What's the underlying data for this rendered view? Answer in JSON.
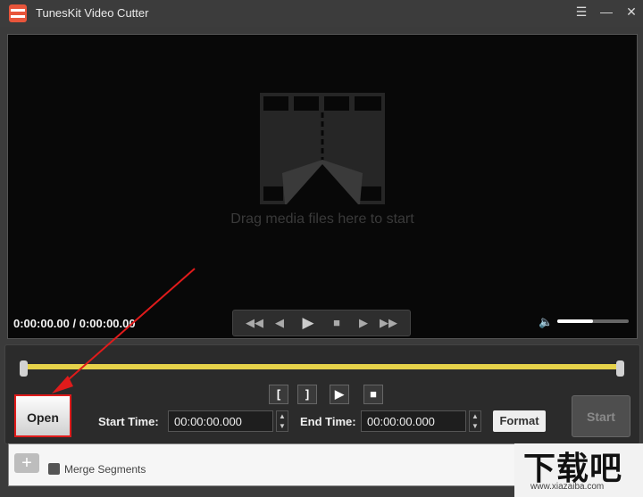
{
  "window": {
    "title": "TunesKit Video Cutter",
    "controls": [
      "menu-icon",
      "minimize-icon",
      "close-icon"
    ]
  },
  "player": {
    "placeholder": "Drag media files here to start",
    "time_display": "0:00:00.00 / 0:00:00.00",
    "volume_level": 0.5
  },
  "transport": {
    "buttons": [
      "skip-to-start-icon",
      "step-back-icon",
      "play-icon",
      "stop-icon",
      "step-forward-icon",
      "skip-to-end-icon"
    ]
  },
  "segment_controls": [
    "set-start-marker-icon",
    "set-end-marker-icon",
    "preview-segment-icon",
    "stop-preview-icon"
  ],
  "editor": {
    "open_label": "Open",
    "start_time_label": "Start Time:",
    "start_time_value": "00:00:00.000",
    "end_time_label": "End Time:",
    "end_time_value": "00:00:00.000",
    "format_label": "Format",
    "start_label": "Start"
  },
  "segments": {
    "merge_label": "Merge Segments"
  },
  "watermark": {
    "main": "下载吧",
    "sub": "www.xiazaiba.com"
  },
  "colors": {
    "accent_timeline": "#e6d24a",
    "highlight": "#e01b1b",
    "app_icon": "#e8553b"
  }
}
